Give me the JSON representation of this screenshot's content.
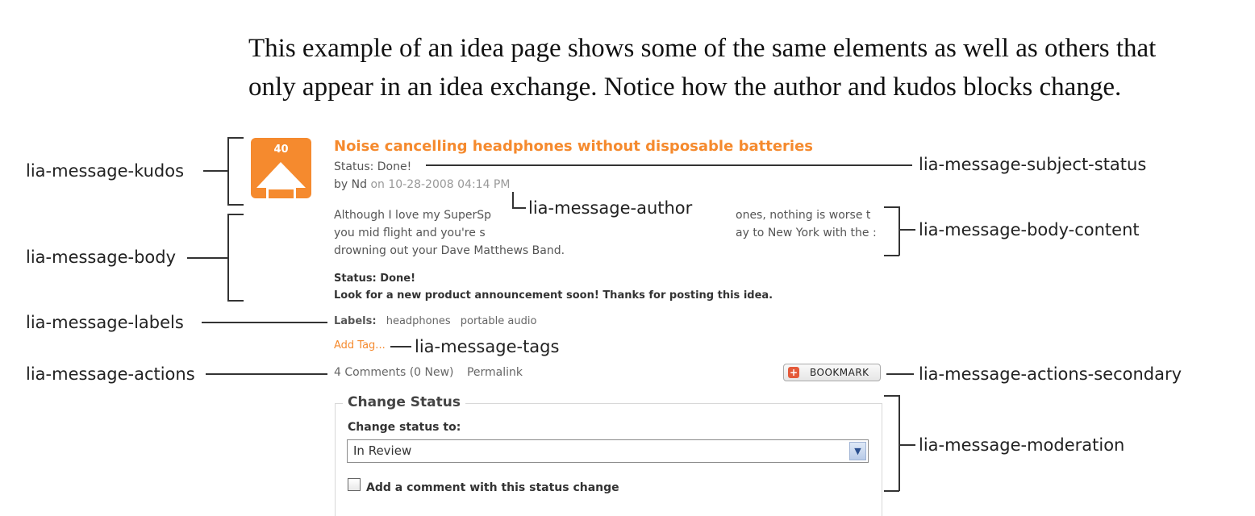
{
  "intro": {
    "line1": "This example of an idea page shows some of the same elements as well as others that",
    "line2": "only appear in an idea exchange. Notice how the author and kudos blocks change."
  },
  "annotations": {
    "kudos": "lia-message-kudos",
    "body": "lia-message-body",
    "labels": "lia-message-labels",
    "actions": "lia-message-actions",
    "subject_status": "lia-message-subject-status",
    "author": "lia-message-author",
    "body_content": "lia-message-body-content",
    "tags": "lia-message-tags",
    "actions_secondary": "lia-message-actions-secondary",
    "moderation": "lia-message-moderation"
  },
  "message": {
    "kudos_count": "40",
    "subject": "Noise cancelling headphones without disposable batteries",
    "status_line": "Status: Done!",
    "by_prefix": "by",
    "author": "Nd",
    "date": "on 10-28-2008 04:14 PM",
    "body_lines": [
      "Although I love my SuperSp",
      "you mid flight and you're s",
      "drowning out your Dave Matthews Band."
    ],
    "body_lines_right": [
      "ones, nothing is worse t",
      "ay to New York with the :"
    ],
    "status_bold": "Status: Done!",
    "announcement": "Look for a new product announcement soon! Thanks for posting this idea.",
    "labels_prefix": "Labels:",
    "labels": [
      "headphones",
      "portable audio"
    ],
    "add_tag": "Add Tag...",
    "comments": "4 Comments (0 New)",
    "permalink": "Permalink",
    "bookmark": "BOOKMARK"
  },
  "moderation": {
    "legend": "Change Status",
    "change_to_label": "Change status to:",
    "selected_status": "In Review",
    "comment_checkbox_label": "Add a comment with this status change"
  },
  "colors": {
    "accent_orange": "#f58a2e"
  }
}
